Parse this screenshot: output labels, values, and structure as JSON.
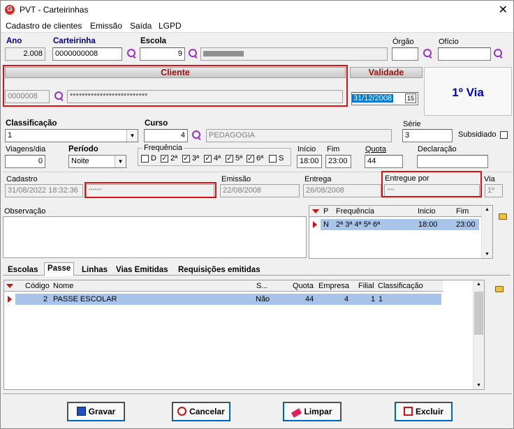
{
  "window": {
    "title": "PVT - Carteirinhas",
    "close": "✕"
  },
  "menu": [
    "Cadastro de clientes",
    "Emissão",
    "Saída",
    "LGPD"
  ],
  "top": {
    "ano_label": "Ano",
    "ano": "2.008",
    "carteirinha_label": "Carteirinha",
    "carteirinha": "0000000008",
    "escola_label": "Escola",
    "escola_code": "9",
    "orgao_label": "Órgão",
    "oficio_label": "Ofício"
  },
  "cliente": {
    "header": "Cliente",
    "code": "0000008",
    "name": "**************************"
  },
  "validade": {
    "header": "Validade",
    "date": "31/12/2008",
    "cal": "15"
  },
  "via_text": "1º Via",
  "classif": {
    "label": "Classificação",
    "value": "1",
    "curso_label": "Curso",
    "curso_code": "4",
    "curso_name": "PEDAGOGIA",
    "serie_label": "Série",
    "serie": "3",
    "subsidiado_label": "Subsidiado"
  },
  "viagens": {
    "label": "Viagens/dia",
    "value": "0",
    "periodo_label": "Período",
    "periodo": "Noite",
    "freq_label": "Frequência",
    "days": [
      "D",
      "2ª",
      "3ª",
      "4ª",
      "5ª",
      "6ª",
      "S"
    ],
    "checked": [
      false,
      true,
      true,
      true,
      true,
      true,
      false
    ],
    "inicio_label": "Início",
    "inicio": "18:00",
    "fim_label": "Fim",
    "fim": "23:00",
    "quota_label": "Quota",
    "quota": "44",
    "declaracao_label": "Declaração"
  },
  "status": {
    "cadastro_label": "Cadastro",
    "cadastro": "31/08/2022 18:32:36",
    "cad_user": "*******",
    "emissao_label": "Emissão",
    "emissao": "22/08/2008",
    "entrega_label": "Entrega",
    "entrega": "26/08/2008",
    "entregue_label": "Entregue por",
    "entregue": "****",
    "via_label": "Via",
    "via": "1º"
  },
  "obs_label": "Observação",
  "freq_grid": {
    "cols": [
      "P",
      "Frequência",
      "Inicio",
      "Fim"
    ],
    "row": [
      "N",
      "2ª 3ª 4ª 5ª 6ª",
      "18:00",
      "23:00"
    ]
  },
  "tabs": [
    "Escolas",
    "Passe",
    "Linhas",
    "Vias Emitidas",
    "Requisições emitidas"
  ],
  "passe_grid": {
    "cols": [
      "Código",
      "Nome",
      "S...",
      "Quota",
      "Empresa",
      "Filial",
      "Classificação"
    ],
    "row": [
      "2",
      "PASSE ESCOLAR",
      "Não",
      "44",
      "4",
      "1",
      "1"
    ]
  },
  "buttons": {
    "gravar": "Gravar",
    "cancelar": "Cancelar",
    "limpar": "Limpar",
    "excluir": "Excluir"
  }
}
